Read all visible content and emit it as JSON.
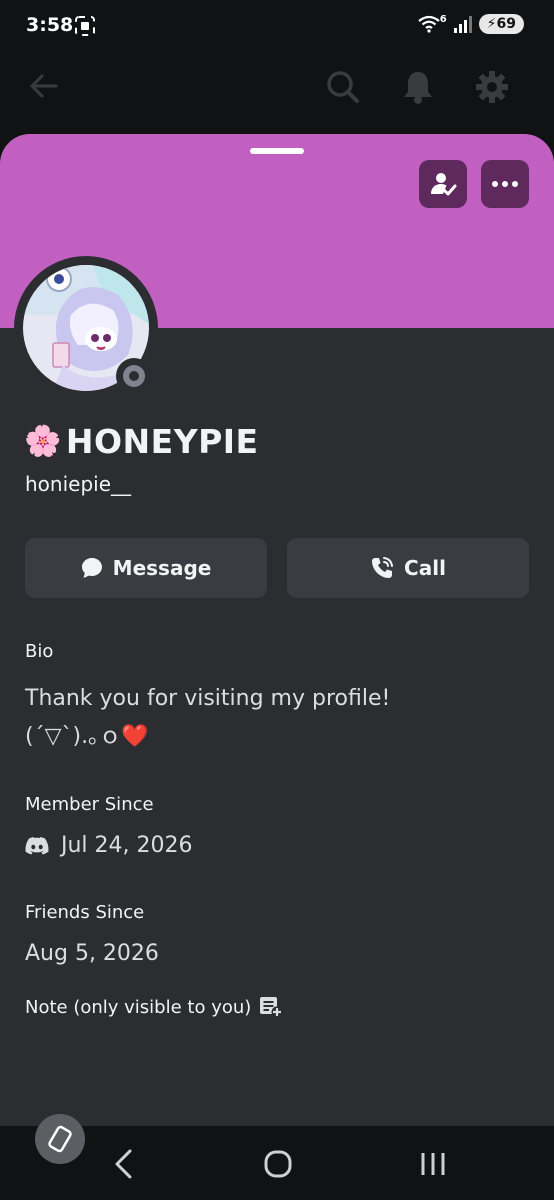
{
  "status_bar": {
    "time": "3:58",
    "network": "6",
    "battery": "69"
  },
  "profile": {
    "display_name": "HONEYPIE",
    "name_emoji": "🌸",
    "username": "honiepie__",
    "banner_color": "#c260c2",
    "online_status": "offline"
  },
  "actions": {
    "message_label": "Message",
    "call_label": "Call"
  },
  "bio": {
    "label": "Bio",
    "line1": "Thank you for visiting my profile!",
    "line2": "(´▽`).｡ｏ",
    "heart": "❤️"
  },
  "member_since": {
    "label": "Member Since",
    "date": "Jul 24, 2026"
  },
  "friends_since": {
    "label": "Friends Since",
    "date": "Aug 5, 2026"
  },
  "note": {
    "label": "Note (only visible to you)"
  },
  "icons": [
    "back-arrow-icon",
    "search-icon",
    "bell-icon",
    "gear-icon",
    "friend-check-icon",
    "more-icon",
    "chat-bubble-icon",
    "phone-icon",
    "discord-icon",
    "note-add-icon",
    "nav-back-icon",
    "nav-home-icon",
    "nav-recents-icon",
    "rotate-icon"
  ]
}
